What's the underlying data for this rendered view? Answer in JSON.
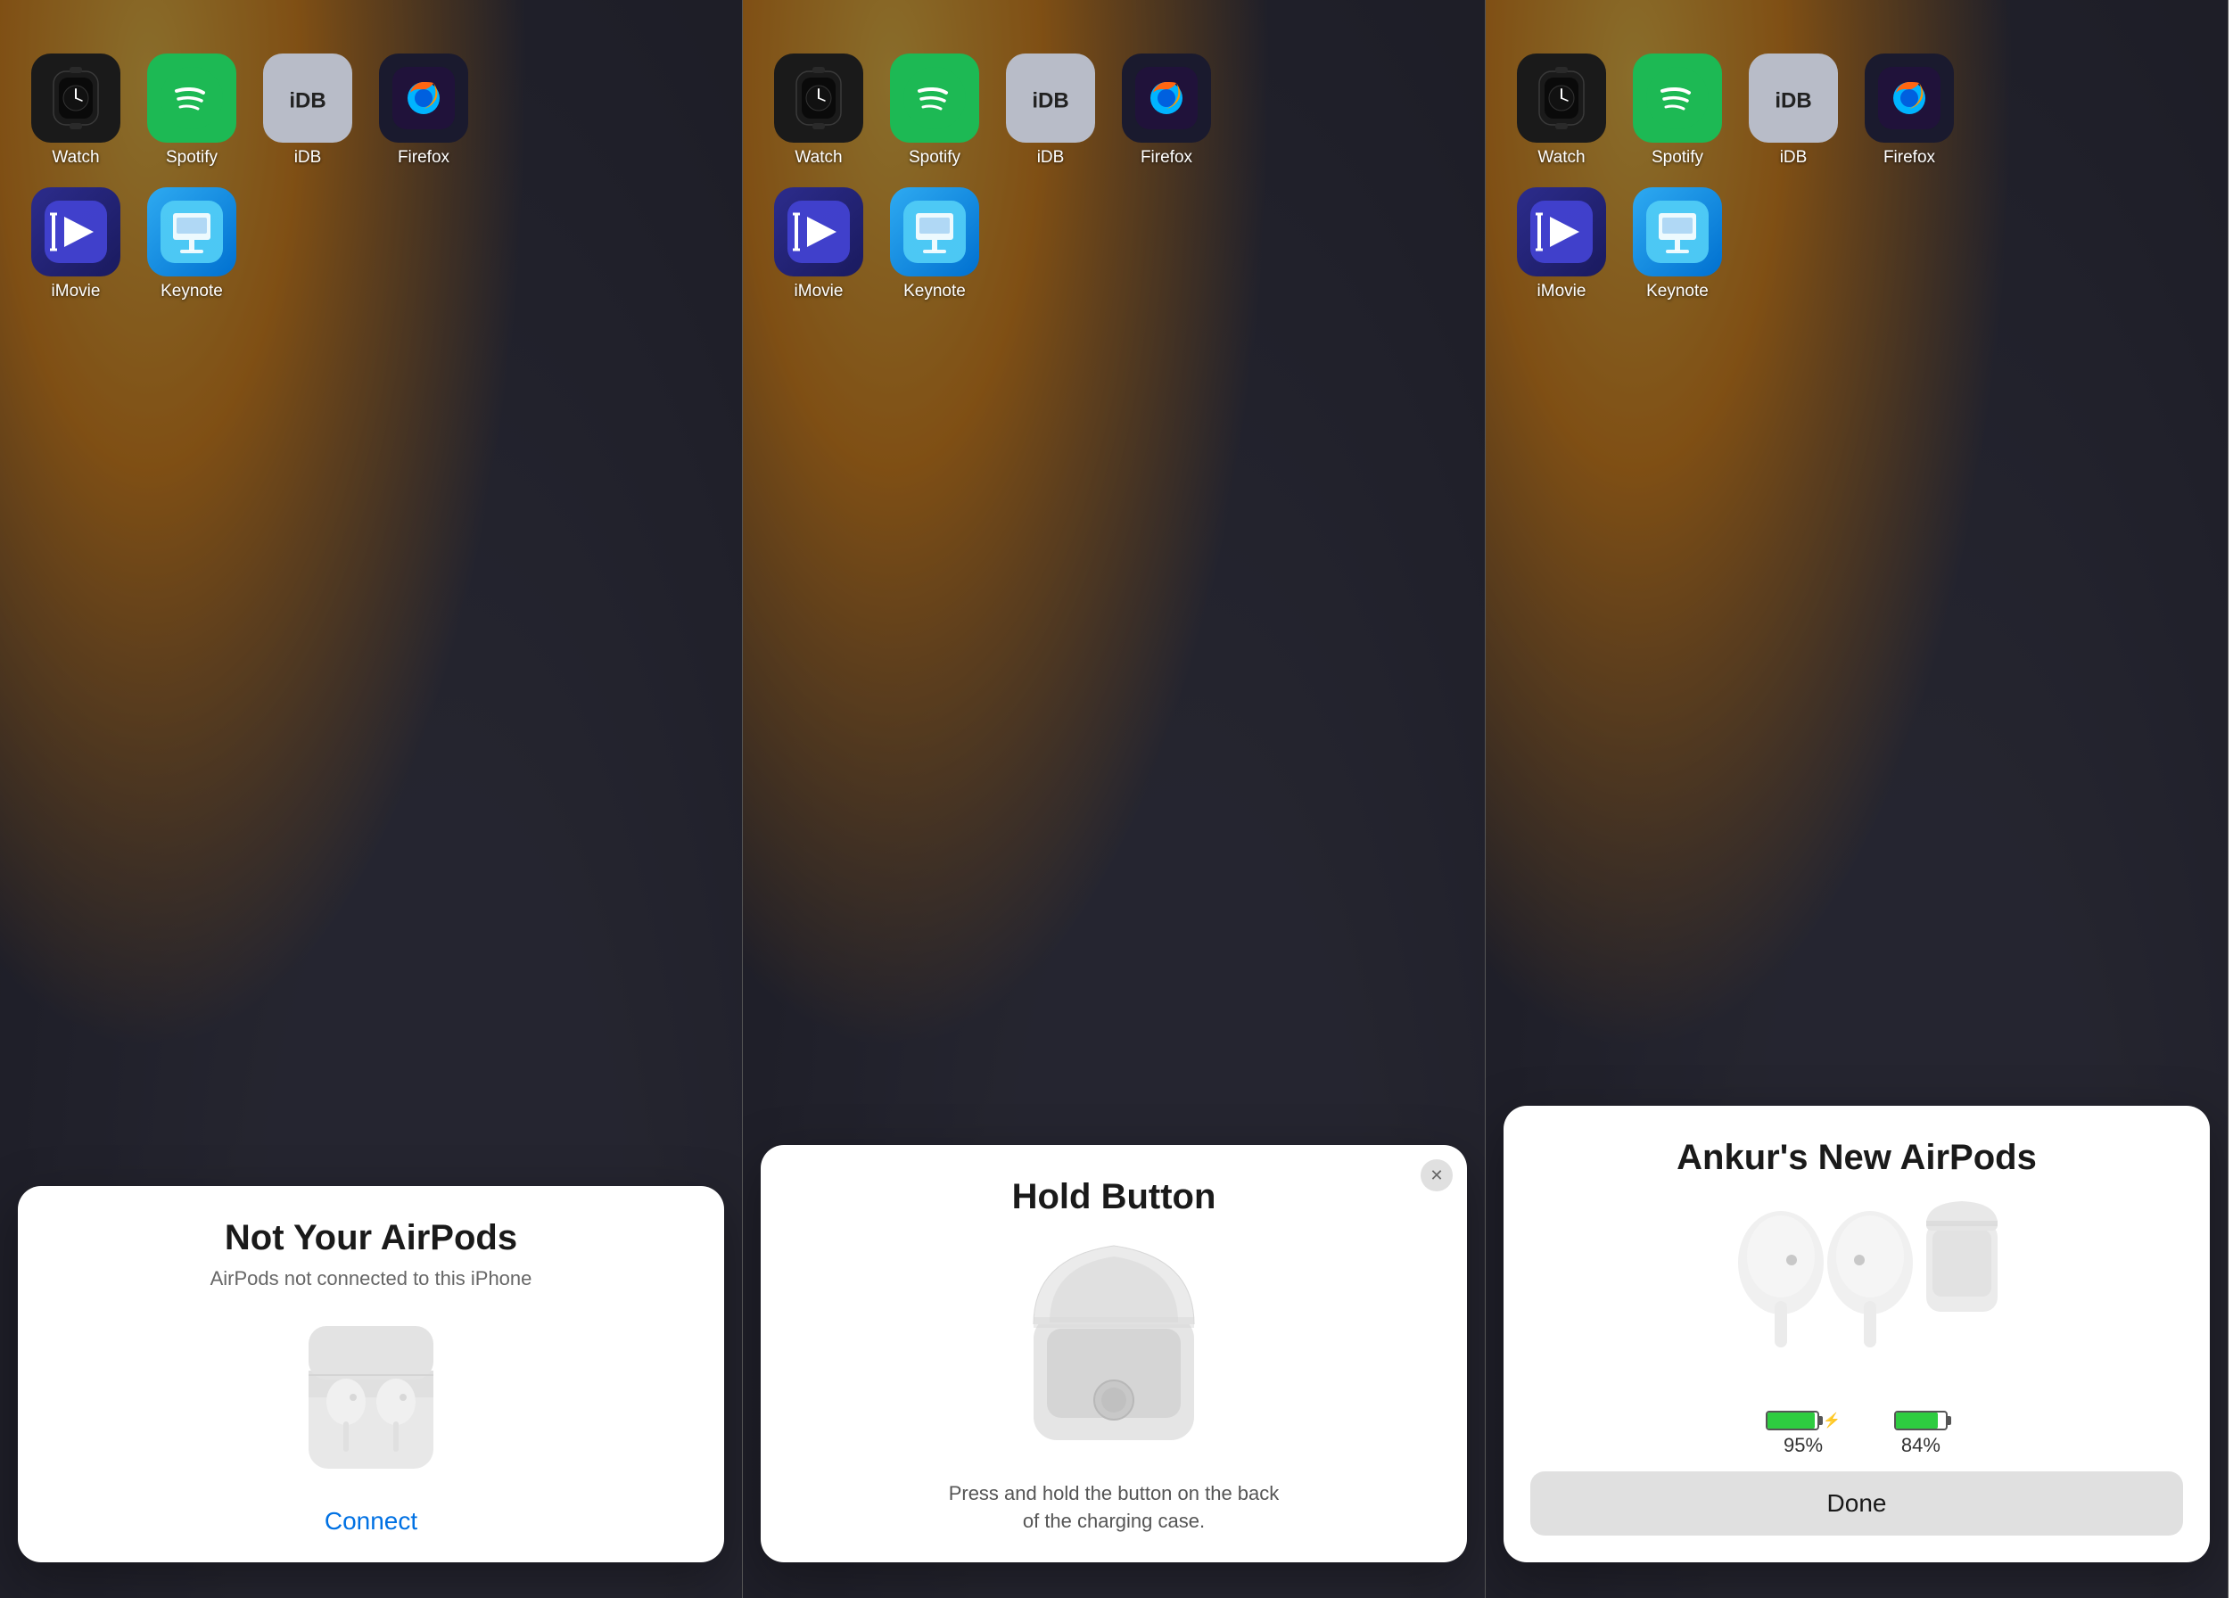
{
  "panels": [
    {
      "id": "panel1",
      "apps": [
        {
          "name": "Watch",
          "icon": "watch"
        },
        {
          "name": "Spotify",
          "icon": "spotify"
        },
        {
          "name": "iDB",
          "icon": "idb"
        },
        {
          "name": "Firefox",
          "icon": "firefox"
        },
        {
          "name": "iMovie",
          "icon": "imovie"
        },
        {
          "name": "Keynote",
          "icon": "keynote"
        }
      ],
      "popup": {
        "type": "not-yours",
        "title": "Not Your AirPods",
        "subtitle": "AirPods not connected to this iPhone",
        "connect_label": "Connect"
      }
    },
    {
      "id": "panel2",
      "apps": [
        {
          "name": "Watch",
          "icon": "watch"
        },
        {
          "name": "Spotify",
          "icon": "spotify"
        },
        {
          "name": "iDB",
          "icon": "idb"
        },
        {
          "name": "Firefox",
          "icon": "firefox"
        },
        {
          "name": "iMovie",
          "icon": "imovie"
        },
        {
          "name": "Keynote",
          "icon": "keynote"
        }
      ],
      "popup": {
        "type": "hold-button",
        "title": "Hold Button",
        "body": "Press and hold the button on the back\nof the charging case."
      }
    },
    {
      "id": "panel3",
      "apps": [
        {
          "name": "Watch",
          "icon": "watch"
        },
        {
          "name": "Spotify",
          "icon": "spotify"
        },
        {
          "name": "iDB",
          "icon": "idb"
        },
        {
          "name": "Firefox",
          "icon": "firefox"
        },
        {
          "name": "iMovie",
          "icon": "imovie"
        },
        {
          "name": "Keynote",
          "icon": "keynote"
        }
      ],
      "popup": {
        "type": "connected",
        "title": "Ankur's New AirPods",
        "left_pct": "95%",
        "right_pct": "84%",
        "done_label": "Done"
      }
    }
  ]
}
